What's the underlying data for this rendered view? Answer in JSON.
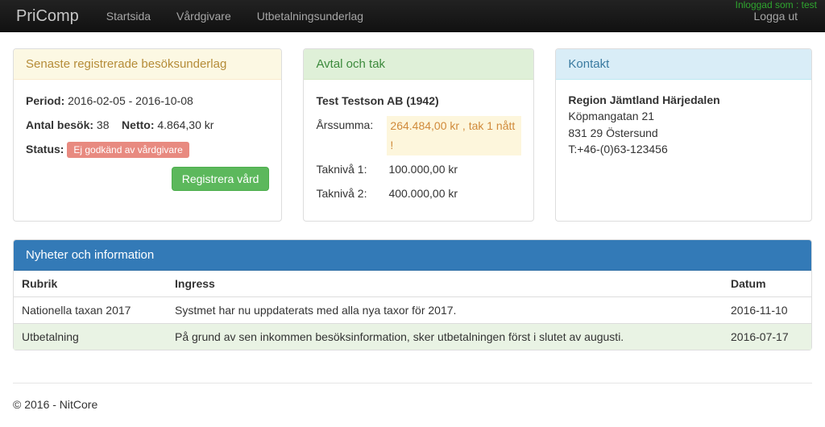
{
  "nav": {
    "brand": "PriComp",
    "links": [
      "Startsida",
      "Vårdgivare",
      "Utbetalningsunderlag"
    ],
    "logout": "Logga ut",
    "logged_in": "Inloggad som : test"
  },
  "panels": {
    "latest": {
      "title": "Senaste registrerade besöksunderlag",
      "period_label": "Period:",
      "period_value": "2016-02-05 - 2016-10-08",
      "count_label": "Antal besök:",
      "count_value": "38",
      "net_label": "Netto:",
      "net_value": "4.864,30 kr",
      "status_label": "Status:",
      "status_badge": "Ej godkänd av vårdgivare",
      "register_btn": "Registrera vård"
    },
    "agreement": {
      "title": "Avtal och tak",
      "company": "Test Testson AB (1942)",
      "year_sum_label": "Årssumma:",
      "year_sum_value": "264.484,00 kr , tak 1 nått !",
      "level1_label": "Taknivå 1:",
      "level1_value": "100.000,00 kr",
      "level2_label": "Taknivå 2:",
      "level2_value": "400.000,00 kr"
    },
    "contact": {
      "title": "Kontakt",
      "name": "Region Jämtland Härjedalen",
      "street": "Köpmangatan 21",
      "postal": "831 29 Östersund",
      "phone": "T:+46-(0)63-123456"
    }
  },
  "news": {
    "title": "Nyheter och information",
    "headers": {
      "rubrik": "Rubrik",
      "ingress": "Ingress",
      "datum": "Datum"
    },
    "rows": [
      {
        "rubrik": "Nationella taxan 2017",
        "ingress": "Systmet har nu uppdaterats med alla nya taxor för 2017.",
        "datum": "2016-11-10"
      },
      {
        "rubrik": "Utbetalning",
        "ingress": "På grund av sen inkommen besöksinformation, sker utbetalningen först i slutet av augusti.",
        "datum": "2016-07-17"
      }
    ]
  },
  "footer": "© 2016 - NitCore"
}
